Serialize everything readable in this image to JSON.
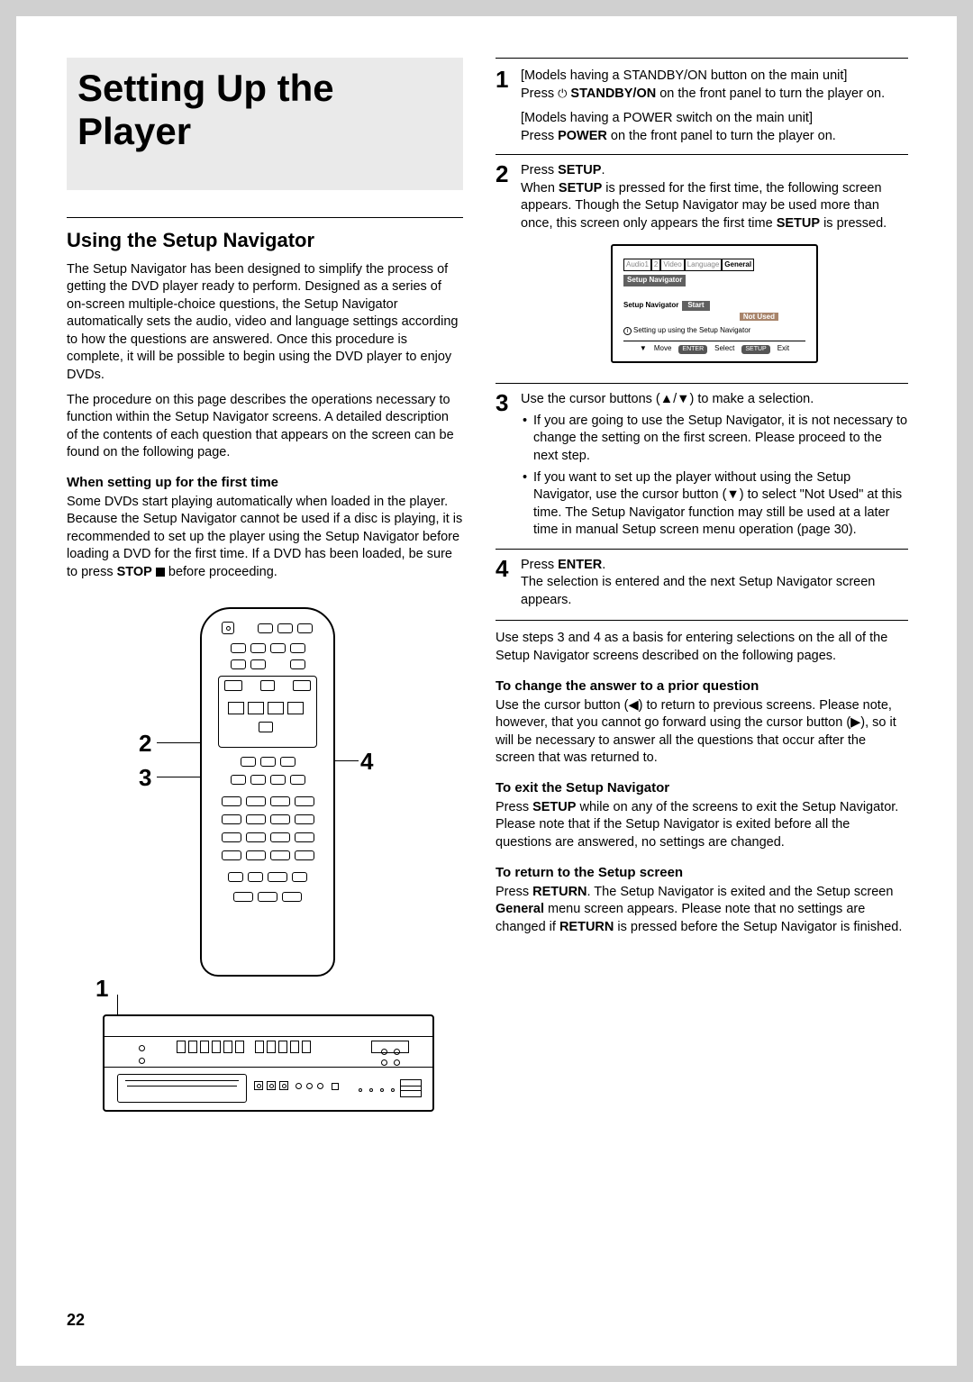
{
  "title": "Setting Up the Player",
  "section_heading": "Using the Setup Navigator",
  "intro_p1": "The Setup Navigator has been designed to simplify the process of getting the DVD player ready to perform. Designed as a series of on-screen multiple-choice questions, the Setup Navigator automatically sets the audio, video and language settings according to how the questions are answered. Once this procedure is complete, it will be possible to begin using the DVD player to enjoy DVDs.",
  "intro_p2": "The procedure on this page describes the operations necessary to function within the Setup Navigator screens. A detailed description of the contents of each question that appears on the screen can be found on the following page.",
  "first_time_heading": "When setting up for the first time",
  "first_time_text_a": "Some DVDs start playing automatically when loaded in the player. Because the Setup Navigator cannot be used if a disc is playing, it is recommended to set up the player using the Setup Navigator before loading a DVD for the first time. If a DVD has been loaded, be sure to press ",
  "first_time_text_b": " before proceeding.",
  "stop_label": "STOP",
  "diagram_labels": {
    "n1": "1",
    "n2": "2",
    "n3": "3",
    "n4": "4"
  },
  "step1": {
    "line1": "[Models having a STANDBY/ON button on the main unit]",
    "line2a": "Press ",
    "line2b": " STANDBY/ON",
    "line2c": " on the front panel to turn the player on.",
    "line3": "[Models having a POWER switch on the main unit]",
    "line4a": "Press ",
    "line4b": "POWER",
    "line4c": " on the front panel to turn the player on."
  },
  "step2": {
    "head_a": "Press ",
    "head_b": "SETUP",
    "head_c": ".",
    "body_a": "When ",
    "body_b": "SETUP",
    "body_c": " is pressed for the first time, the following screen appears. Though the Setup Navigator may be used more than once, this screen only appears the first time ",
    "body_d": "SETUP",
    "body_e": " is pressed."
  },
  "osd": {
    "tab_audio1": "Audio1",
    "tab_audio2": "2",
    "tab_video": "Video",
    "tab_language": "Language",
    "tab_general": "General",
    "setup_nav": "Setup Navigator",
    "row_label": "Setup Navigator",
    "row_value": "Start",
    "not_used": "Not Used",
    "info": "Setting up using the Setup Navigator",
    "move": "Move",
    "enter": "ENTER",
    "select": "Select",
    "setup": "SETUP",
    "exit": "Exit"
  },
  "step3": {
    "head": "Use the cursor buttons (▲/▼) to make a selection.",
    "b1": "If you are going to use the Setup Navigator, it is not necessary to change the setting on the first screen. Please proceed to the next step.",
    "b2": "If you want to set up the player without using the Setup Navigator, use the cursor button (▼) to select \"Not Used\" at this time. The Setup Navigator function may still be used at a later time in manual Setup screen menu operation (page 30)."
  },
  "step4": {
    "head_a": "Press ",
    "head_b": "ENTER",
    "head_c": ".",
    "body": "The selection is entered and the next Setup Navigator screen appears."
  },
  "after_intro": "Use steps 3 and 4 as a basis for entering selections on the all of the Setup Navigator screens described on the following pages.",
  "change_heading": "To change the answer to a prior question",
  "change_text": "Use the cursor button (◀) to return to previous screens. Please note, however, that you cannot go forward using the cursor button (▶), so it will be necessary to answer all the questions that occur after the screen that was returned to.",
  "exit_heading": "To exit the Setup Navigator",
  "exit_text_a": "Press ",
  "exit_text_b": "SETUP",
  "exit_text_c": " while on any of the screens to exit the Setup Navigator. Please note that if the Setup Navigator is exited before all the questions are answered, no settings are changed.",
  "return_heading": "To return to the Setup screen",
  "return_text_a": "Press ",
  "return_text_b": "RETURN",
  "return_text_c": ". The Setup Navigator is exited and the Setup screen ",
  "return_text_d": "General",
  "return_text_e": " menu screen appears. Please note that no settings are changed if ",
  "return_text_f": "RETURN",
  "return_text_g": " is pressed before the Setup Navigator is finished.",
  "page_number": "22"
}
